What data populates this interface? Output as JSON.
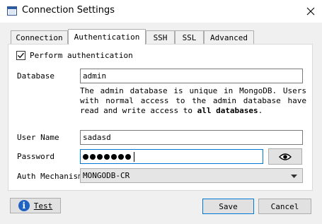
{
  "window": {
    "title": "Connection Settings"
  },
  "tabs": [
    {
      "label": "Connection",
      "active": false
    },
    {
      "label": "Authentication",
      "active": true
    },
    {
      "label": "SSH",
      "active": false
    },
    {
      "label": "SSL",
      "active": false
    },
    {
      "label": "Advanced",
      "active": false
    }
  ],
  "auth": {
    "perform_label": "Perform authentication",
    "perform_checked": true,
    "database_label": "Database",
    "database_value": "admin",
    "description_pre": "The admin database is unique in MongoDB. Users with normal access to the admin database have read and write access to ",
    "description_bold": "all databases",
    "description_post": ".",
    "username_label": "User Name",
    "username_value": "sadasd",
    "password_label": "Password",
    "password_dot_count": 7,
    "mechanism_label": "Auth Mechanism",
    "mechanism_value": "MONGODB-CR"
  },
  "buttons": {
    "test_label": "Test",
    "save_label": "Save",
    "cancel_label": "Cancel"
  },
  "icons": {
    "app": "window-icon",
    "close": "close-icon",
    "eye": "eye-icon",
    "info": "info-icon",
    "dropdown": "chevron-down-icon"
  }
}
